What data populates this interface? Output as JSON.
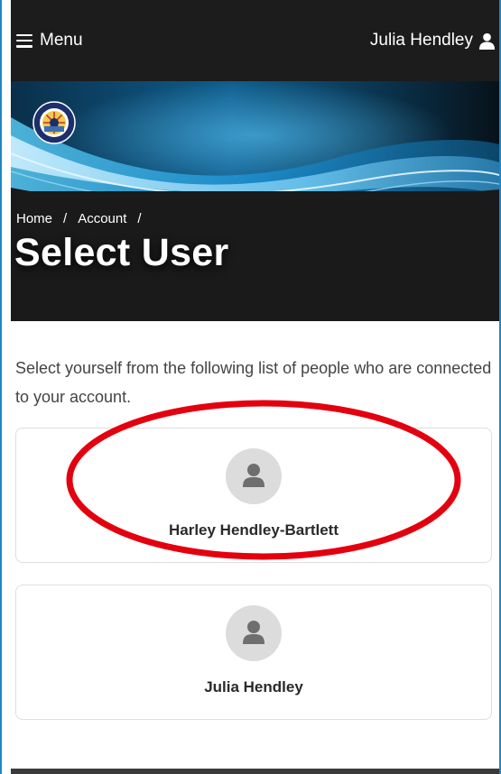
{
  "nav": {
    "menu_label": "Menu",
    "user_name": "Julia Hendley"
  },
  "breadcrumb": {
    "items": [
      "Home",
      "Account"
    ],
    "separator": "/"
  },
  "page": {
    "title": "Select User",
    "intro": "Select yourself from the following list of people who are connected to your account."
  },
  "users": [
    {
      "name": "Harley Hendley-Bartlett"
    },
    {
      "name": "Julia Hendley"
    }
  ],
  "colors": {
    "nav_bg": "#1c1c1c",
    "banner_accent": "#1f9ad6",
    "highlight": "#e3000f",
    "frame_border": "#1e86c8"
  },
  "icons": {
    "menu": "hamburger-icon",
    "user": "user-icon",
    "seal": "city-seal-logo",
    "avatar": "person-silhouette-icon"
  }
}
